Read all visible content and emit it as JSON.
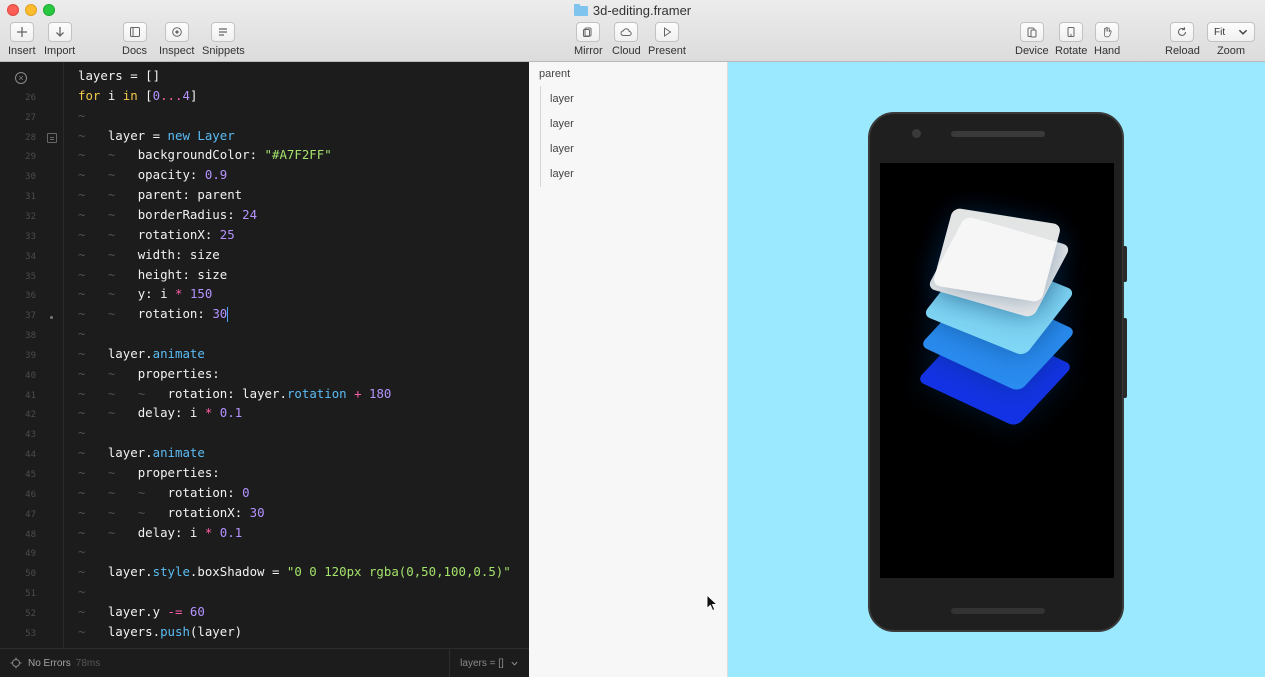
{
  "window": {
    "title": "3d-editing.framer"
  },
  "toolbar": {
    "left": [
      {
        "label": "Insert",
        "icon": "plus-icon"
      },
      {
        "label": "Import",
        "icon": "download-arrow-icon"
      },
      {
        "label": "Docs",
        "icon": "docs-icon"
      },
      {
        "label": "Inspect",
        "icon": "inspect-target-icon"
      },
      {
        "label": "Snippets",
        "icon": "snippets-lines-icon"
      }
    ],
    "center": [
      {
        "label": "Mirror",
        "icon": "mirror-icon"
      },
      {
        "label": "Cloud",
        "icon": "cloud-icon"
      },
      {
        "label": "Present",
        "icon": "play-icon"
      }
    ],
    "right": [
      {
        "label": "Device",
        "icon": "device-icon"
      },
      {
        "label": "Rotate",
        "icon": "rotate-device-icon"
      },
      {
        "label": "Hand",
        "icon": "hand-icon"
      },
      {
        "label": "Reload",
        "icon": "reload-icon"
      }
    ],
    "zoom": {
      "label": "Zoom",
      "value": "Fit"
    }
  },
  "editor": {
    "line_numbers": [
      "26",
      "27",
      "28",
      "29",
      "30",
      "31",
      "32",
      "33",
      "34",
      "35",
      "36",
      "37",
      "38",
      "39",
      "40",
      "41",
      "42",
      "43",
      "44",
      "45",
      "46",
      "47",
      "48",
      "49",
      "50",
      "51",
      "52",
      "53"
    ],
    "lines": [
      "layers = []",
      "for i in [0...4]",
      "~",
      "~   layer = new Layer",
      "~   ~   backgroundColor: \"#A7F2FF\"",
      "~   ~   opacity: 0.9",
      "~   ~   parent: parent",
      "~   ~   borderRadius: 24",
      "~   ~   rotationX: 25",
      "~   ~   width: size",
      "~   ~   height: size",
      "~   ~   y: i * 150",
      "~   ~   rotation: 30",
      "~",
      "~   layer.animate",
      "~   ~   properties:",
      "~   ~   ~   rotation: layer.rotation + 180",
      "~   ~   delay: i * 0.1",
      "~",
      "~   layer.animate",
      "~   ~   properties:",
      "~   ~   ~   rotation: 0",
      "~   ~   ~   rotationX: 30",
      "~   ~   delay: i * 0.1",
      "~",
      "~   layer.style.boxShadow = \"0 0 120px rgba(0,50,100,0.5)\"",
      "~",
      "~   layer.y -= 60",
      "~   layers.push(layer)"
    ]
  },
  "status": {
    "errors": "No Errors",
    "time": "78ms",
    "symbol": "layers = []"
  },
  "layers_panel": {
    "root": "parent",
    "children": [
      "layer",
      "layer",
      "layer",
      "layer"
    ]
  },
  "preview": {
    "background": "#9be9fe",
    "card_colors": [
      "#1433e6",
      "#2a8cf0",
      "#7fd6f5",
      "#ededed",
      "#f7f7f7"
    ]
  }
}
